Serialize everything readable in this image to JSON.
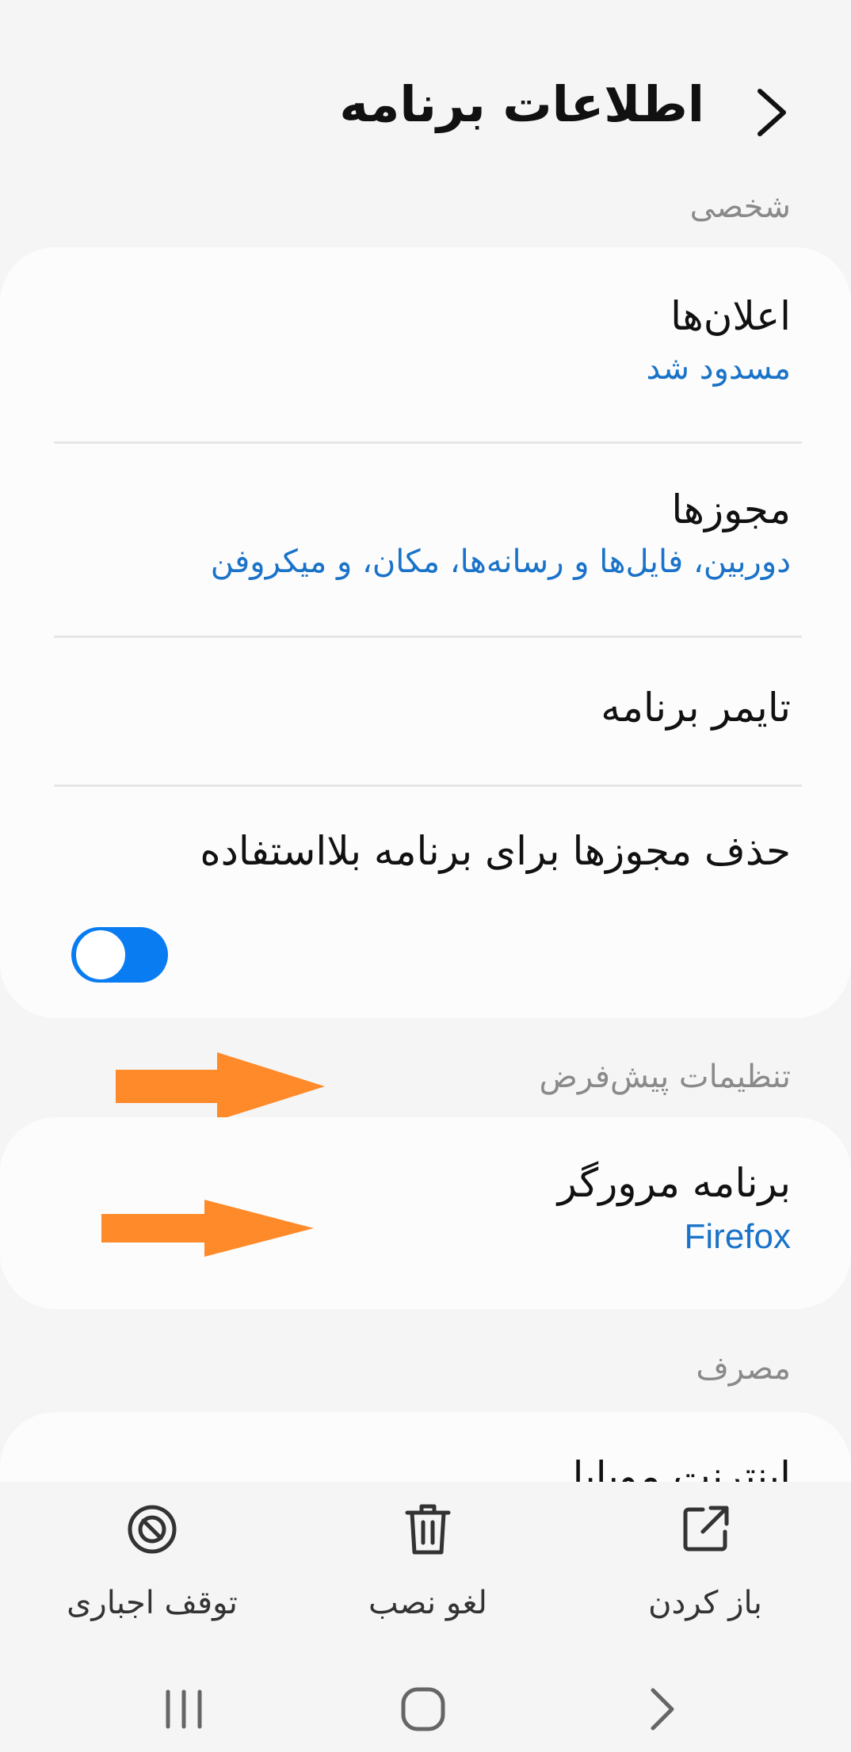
{
  "header": {
    "title": "اطلاعات برنامه"
  },
  "sections": {
    "personal": {
      "label": "شخصی",
      "items": [
        {
          "title": "اعلان‌ها",
          "subtitle": "مسدود شد"
        },
        {
          "title": "مجوزها",
          "subtitle": "دوربین، فایل‌ها و رسانه‌ها، مکان، و میکروفن"
        },
        {
          "title": "تایمر برنامه"
        },
        {
          "title": "حذف مجوزها برای برنامه بلااستفاده",
          "toggle_on": true
        }
      ]
    },
    "defaults": {
      "label": "تنظیمات پیش‌فرض",
      "items": [
        {
          "title": "برنامه مرورگر",
          "subtitle": "Firefox"
        }
      ]
    },
    "usage": {
      "label": "مصرف",
      "peek_item": "اینترنت موبایل"
    }
  },
  "actions": {
    "open": "باز کردن",
    "uninstall": "لغو نصب",
    "force_stop": "توقف اجباری"
  },
  "colors": {
    "accent": "#1a73c9",
    "toggle": "#0a7cf2",
    "annotation_arrow": "#ff8a2a"
  },
  "icons": {
    "back": "chevron-right-icon",
    "open": "open-external-icon",
    "uninstall": "trash-icon",
    "force_stop": "block-icon",
    "nav_recents": "recents-icon",
    "nav_home": "home-icon",
    "nav_back": "nav-back-icon"
  }
}
